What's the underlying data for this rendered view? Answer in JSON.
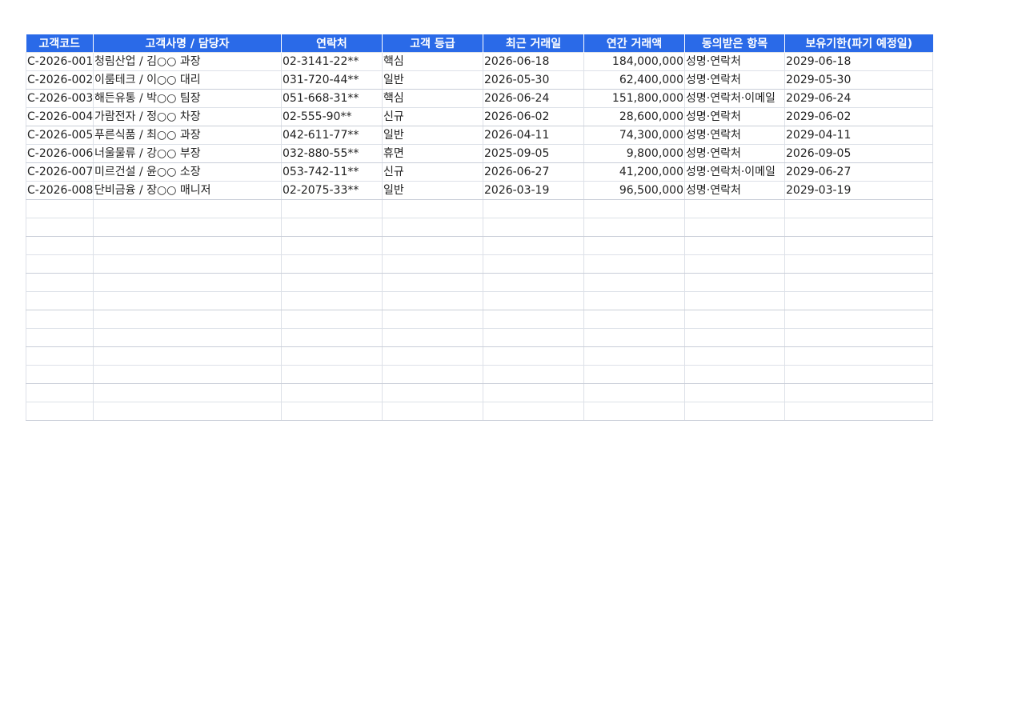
{
  "table": {
    "headers": [
      "고객코드",
      "고객사명 / 담당자",
      "연락처",
      "고객 등급",
      "최근 거래일",
      "연간 거래액",
      "동의받은 항목",
      "보유기한(파기 예정일)"
    ],
    "rows": [
      [
        "C-2026-001",
        "청림산업 / 김○○ 과장",
        "02-3141-22**",
        "핵심",
        "2026-06-18",
        "184,000,000",
        "성명·연락처",
        "2029-06-18"
      ],
      [
        "C-2026-002",
        "이룸테크 / 이○○ 대리",
        "031-720-44**",
        "일반",
        "2026-05-30",
        "62,400,000",
        "성명·연락처",
        "2029-05-30"
      ],
      [
        "C-2026-003",
        "해든유통 / 박○○ 팀장",
        "051-668-31**",
        "핵심",
        "2026-06-24",
        "151,800,000",
        "성명·연락처·이메일",
        "2029-06-24"
      ],
      [
        "C-2026-004",
        "가람전자 / 정○○ 차장",
        "02-555-90**",
        "신규",
        "2026-06-02",
        "28,600,000",
        "성명·연락처",
        "2029-06-02"
      ],
      [
        "C-2026-005",
        "푸른식품 / 최○○ 과장",
        "042-611-77**",
        "일반",
        "2026-04-11",
        "74,300,000",
        "성명·연락처",
        "2029-04-11"
      ],
      [
        "C-2026-006",
        "너울물류 / 강○○ 부장",
        "032-880-55**",
        "휴면",
        "2025-09-05",
        "9,800,000",
        "성명·연락처",
        "2026-09-05"
      ],
      [
        "C-2026-007",
        "미르건설 / 윤○○ 소장",
        "053-742-11**",
        "신규",
        "2026-06-27",
        "41,200,000",
        "성명·연락처·이메일",
        "2029-06-27"
      ],
      [
        "C-2026-008",
        "단비금융 / 장○○ 매니저",
        "02-2075-33**",
        "일반",
        "2026-03-19",
        "96,500,000",
        "성명·연락처",
        "2029-03-19"
      ]
    ],
    "empty_row_count": 12
  }
}
